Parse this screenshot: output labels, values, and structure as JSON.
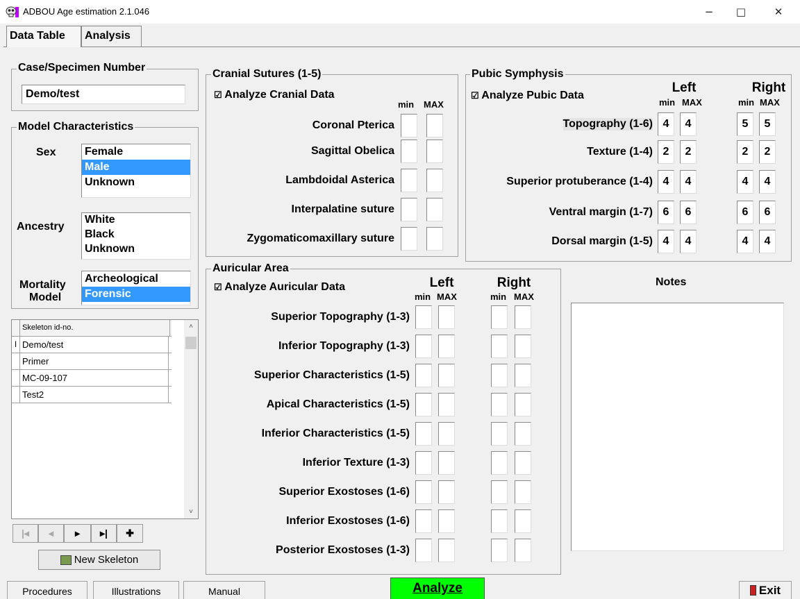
{
  "window": {
    "title": "ADBOU Age estimation 2.1.046",
    "minimize": "−",
    "maximize": "□",
    "close": "✕"
  },
  "tabs": [
    {
      "label": "Data Table"
    },
    {
      "label": "Analysis"
    }
  ],
  "case": {
    "label": "Case/Specimen Number",
    "value": "Demo/test"
  },
  "model": {
    "label": "Model Characteristics",
    "sex_label": "Sex",
    "sex_options": [
      "Female",
      "Male",
      "Unknown"
    ],
    "sex_selected": "Male",
    "ancestry_label": "Ancestry",
    "ancestry_options": [
      "White",
      "Black",
      "Unknown"
    ],
    "mortality_label_1": "Mortality",
    "mortality_label_2": "Model",
    "mortality_options": [
      "Archeological",
      "Forensic"
    ],
    "mortality_selected": "Forensic"
  },
  "skeleton_grid": {
    "header": "Skeleton id-no.",
    "rows": [
      "Demo/test",
      "Primer",
      "MC-09-107",
      "Test2"
    ],
    "current_marker": "I"
  },
  "nav": {
    "first": "|◂",
    "prev": "◂",
    "next": "▸",
    "last": "▸|",
    "add": "✚"
  },
  "new_skeleton": "New Skeleton",
  "cranial": {
    "label": "Cranial Sutures (1-5)",
    "analyze": "Analyze Cranial Data",
    "min": "min",
    "max": "MAX",
    "rows": [
      {
        "name": "Coronal Pterica",
        "min": "",
        "max": ""
      },
      {
        "name": "Sagittal Obelica",
        "min": "",
        "max": ""
      },
      {
        "name": "Lambdoidal Asterica",
        "min": "",
        "max": ""
      },
      {
        "name": "Interpalatine suture",
        "min": "",
        "max": ""
      },
      {
        "name": "Zygomaticomaxillary suture",
        "min": "",
        "max": ""
      }
    ]
  },
  "pubic": {
    "label": "Pubic Symphysis",
    "analyze": "Analyze Pubic Data",
    "left": "Left",
    "right": "Right",
    "min": "min",
    "max": "MAX",
    "rows": [
      {
        "name": "Topography (1-6)",
        "lmin": "4",
        "lmax": "4",
        "rmin": "5",
        "rmax": "5"
      },
      {
        "name": "Texture (1-4)",
        "lmin": "2",
        "lmax": "2",
        "rmin": "2",
        "rmax": "2"
      },
      {
        "name": "Superior protuberance (1-4)",
        "lmin": "4",
        "lmax": "4",
        "rmin": "4",
        "rmax": "4"
      },
      {
        "name": "Ventral margin (1-7)",
        "lmin": "6",
        "lmax": "6",
        "rmin": "6",
        "rmax": "6"
      },
      {
        "name": "Dorsal margin (1-5)",
        "lmin": "4",
        "lmax": "4",
        "rmin": "4",
        "rmax": "4"
      }
    ]
  },
  "auricular": {
    "label": "Auricular Area",
    "analyze": "Analyze Auricular Data",
    "left": "Left",
    "right": "Right",
    "min": "min",
    "max": "MAX",
    "rows": [
      {
        "name": "Superior Topography (1-3)"
      },
      {
        "name": "Inferior Topography (1-3)"
      },
      {
        "name": "Superior Characteristics (1-5)"
      },
      {
        "name": "Apical Characteristics (1-5)"
      },
      {
        "name": "Inferior Characteristics (1-5)"
      },
      {
        "name": "Inferior Texture (1-3)"
      },
      {
        "name": "Superior Exostoses (1-6)"
      },
      {
        "name": "Inferior Exostoses (1-6)"
      },
      {
        "name": "Posterior Exostoses (1-3)"
      }
    ]
  },
  "notes": {
    "label": "Notes",
    "value": ""
  },
  "bottom": {
    "procedures": "Procedures",
    "illustrations": "Illustrations",
    "manual": "Manual",
    "analyze": "Analyze",
    "exit": "Exit"
  },
  "colors": {
    "selection": "#3399ff",
    "analyze_bg": "#00ff00"
  }
}
